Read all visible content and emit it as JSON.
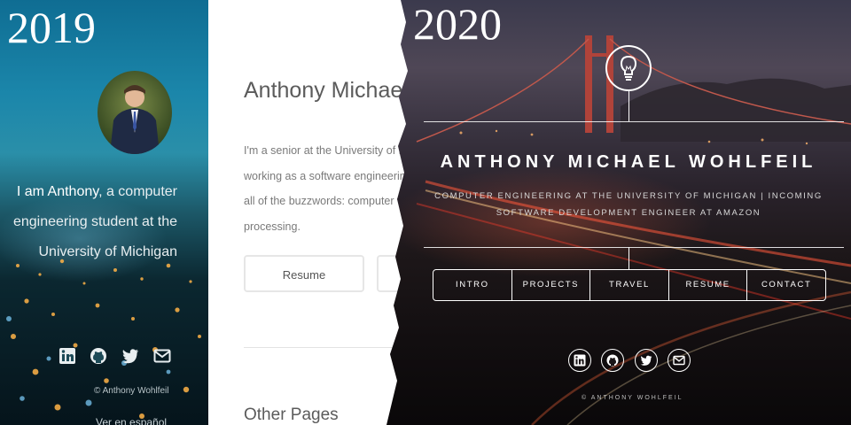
{
  "year_2019": "2019",
  "year_2020": "2020",
  "v2019": {
    "sidebar": {
      "intro_line1_strong": "I am Anthony",
      "intro_line1_rest": ", a computer",
      "intro_line2": "engineering student at the",
      "intro_line3": "University of Michigan",
      "copyright": "© Anthony Wohlfeil",
      "spanish_link": "Ver en español",
      "icons": [
        "linkedin-icon",
        "github-icon",
        "twitter-icon",
        "mail-icon"
      ]
    },
    "main": {
      "name": "Anthony Michael W",
      "bio_lines": [
        "I'm a senior at the University of Mi",
        "working as a software engineering",
        "all of the buzzwords: computer v",
        "processing."
      ],
      "buttons": [
        "Resume",
        ""
      ],
      "other_pages_heading": "Other Pages"
    }
  },
  "v2020": {
    "name": "ANTHONY MICHAEL WOHLFEIL",
    "tagline_line1": "COMPUTER ENGINEERING AT THE UNIVERSITY OF MICHIGAN | INCOMING",
    "tagline_line2": "SOFTWARE DEVELOPMENT ENGINEER AT AMAZON",
    "nav": [
      "INTRO",
      "PROJECTS",
      "TRAVEL",
      "RESUME",
      "CONTACT"
    ],
    "social_icons": [
      "linkedin-icon",
      "github-icon",
      "twitter-icon",
      "mail-icon"
    ],
    "copyright": "© ANTHONY WOHLFEIL",
    "logo_icon": "lightbulb-icon"
  }
}
